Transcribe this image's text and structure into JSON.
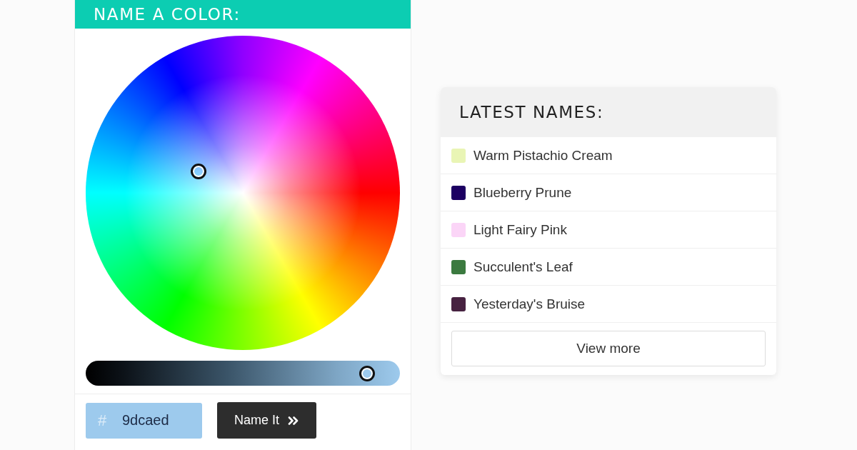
{
  "color_panel": {
    "title": "NAME A COLOR:",
    "brightness_slider": {
      "level": 0.93
    },
    "hex_field": {
      "prefix": "#",
      "value": "9dcaed"
    },
    "submit_button": {
      "label": "Name It"
    }
  },
  "latest_names": {
    "title": "LATEST NAMES:",
    "items": [
      {
        "name": "Warm Pistachio Cream",
        "color": "#e9f5b5"
      },
      {
        "name": "Blueberry Prune",
        "color": "#1c0062"
      },
      {
        "name": "Light Fairy Pink",
        "color": "#fbd5f7"
      },
      {
        "name": "Succulent's Leaf",
        "color": "#3b7a3f"
      },
      {
        "name": "Yesterday's Bruise",
        "color": "#472241"
      }
    ],
    "view_more_button": "View more"
  }
}
